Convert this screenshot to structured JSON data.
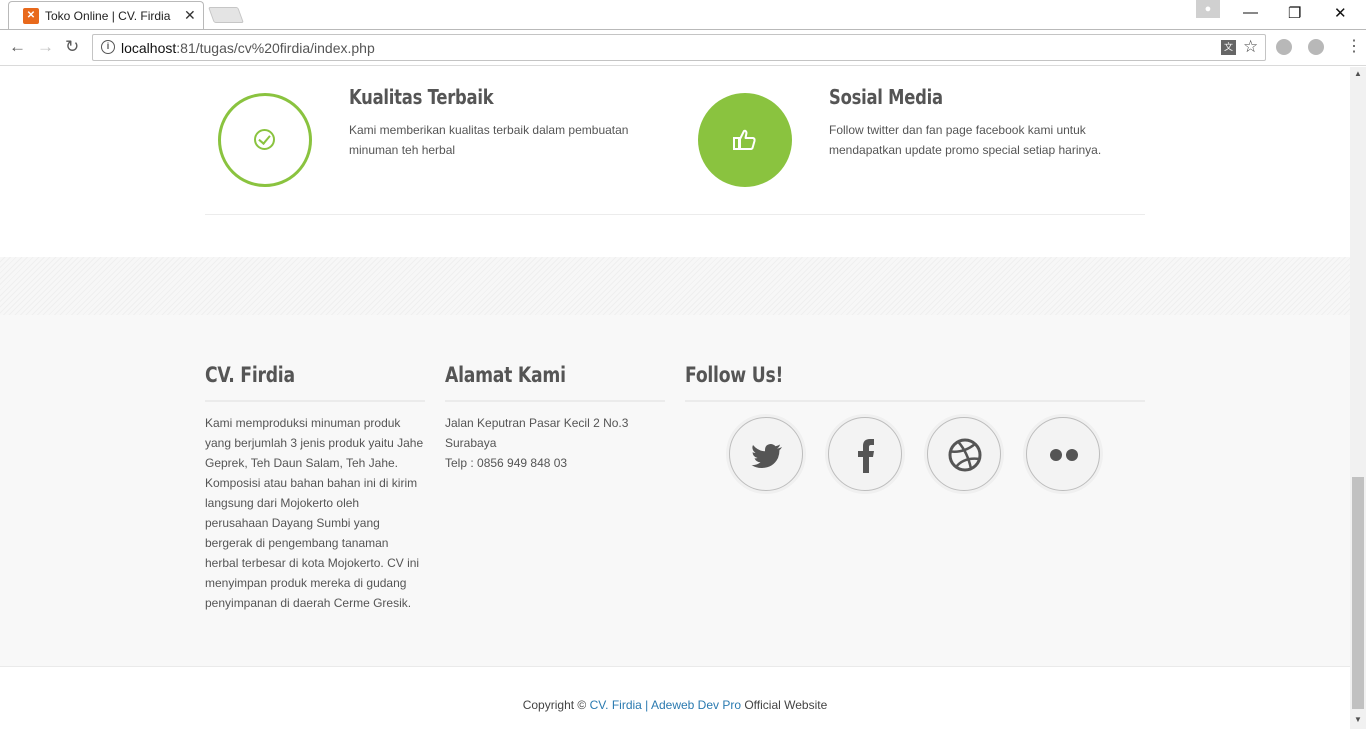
{
  "browser": {
    "tab_title": "Toko Online | CV. Firdia",
    "url_host": "localhost",
    "url_path": ":81/tugas/cv%20firdia/index.php"
  },
  "features": [
    {
      "title": "Kualitas Terbaik",
      "desc_line1": "Kami memberikan kualitas terbaik dalam pembuatan",
      "desc_line2": "minuman teh herbal",
      "icon": "check-circle-icon"
    },
    {
      "title": "Sosial Media",
      "desc_line1": "Follow twitter dan fan page facebook kami untuk",
      "desc_line2": "mendapatkan update promo special setiap harinya.",
      "icon": "thumbs-up-icon"
    }
  ],
  "footer": {
    "about": {
      "title": "CV. Firdia",
      "lines": [
        "Kami memproduksi minuman produk",
        "yang berjumlah 3 jenis produk yaitu Jahe",
        "Geprek, Teh Daun Salam, Teh Jahe.",
        "Komposisi atau bahan bahan ini di kirim",
        "langsung dari Mojokerto oleh",
        "perusahaan Dayang Sumbi yang",
        "bergerak di pengembang tanaman",
        "herbal terbesar di kota Mojokerto. CV ini",
        "menyimpan produk mereka di gudang",
        "penyimpanan di daerah Cerme Gresik."
      ]
    },
    "address": {
      "title": "Alamat Kami",
      "lines": [
        "Jalan Keputran Pasar Kecil 2 No.3",
        "Surabaya",
        "Telp : 0856 949 848 03"
      ]
    },
    "follow": {
      "title": "Follow Us!",
      "icons": [
        "twitter-icon",
        "facebook-icon",
        "dribbble-icon",
        "flickr-icon"
      ]
    }
  },
  "copyright": {
    "prefix": "Copyright © ",
    "link1": "CV. Firdia",
    "sep": " | ",
    "link2": "Adeweb Dev Pro",
    "suffix": " Official Website"
  },
  "colors": {
    "accent": "#8ac33f",
    "link": "#2a7ab0"
  }
}
